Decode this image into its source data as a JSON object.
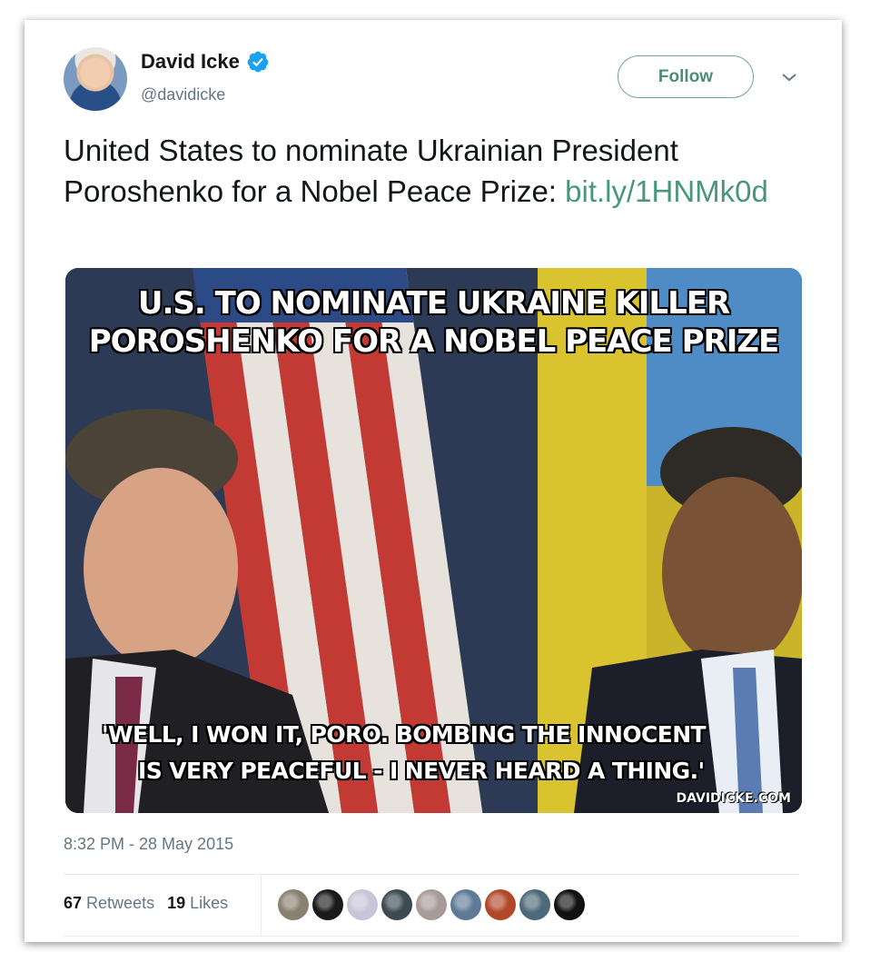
{
  "author": {
    "display_name": "David Icke",
    "handle": "@davidicke",
    "verified": true
  },
  "follow_button": {
    "label": "Follow"
  },
  "tweet": {
    "text": "United States to nominate Ukrainian President Poroshenko for a Nobel Peace Prize: ",
    "link_text": "bit.ly/1HNMk0d",
    "timestamp": "8:32 PM - 28 May 2015"
  },
  "media": {
    "top_caption_line1": "U.S. TO NOMINATE UKRAINE KILLER",
    "top_caption_line2": "POROSHENKO FOR A NOBEL PEACE PRIZE",
    "bottom_caption_line1": "'WELL, I WON IT, PORO. BOMBING THE INNOCENT",
    "bottom_caption_line2": "IS VERY PEACEFUL - I NEVER HEARD A THING.'",
    "watermark": "DAVIDICKE.COM"
  },
  "stats": {
    "retweets_count": "67",
    "retweets_label": "Retweets",
    "likes_count": "19",
    "likes_label": "Likes"
  },
  "likers": [
    {
      "color": "#8a8070"
    },
    {
      "color": "#1a1a1a"
    },
    {
      "color": "#c9c5d8"
    },
    {
      "color": "#3c4a52"
    },
    {
      "color": "#a89a98"
    },
    {
      "color": "#5f7a96"
    },
    {
      "color": "#b2482a"
    },
    {
      "color": "#4d6a7a"
    },
    {
      "color": "#111111"
    }
  ],
  "colors": {
    "accent_link": "#49977a",
    "follow_border": "#6ea691",
    "verified_badge": "#1da1f2",
    "secondary_text": "#657786"
  }
}
